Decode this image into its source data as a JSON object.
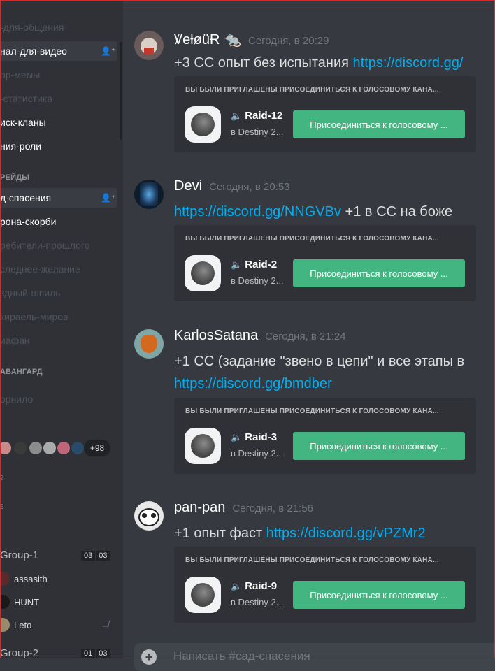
{
  "sidebar": {
    "channels": [
      {
        "label": "-для-общения",
        "state": "dim"
      },
      {
        "label": "нал-для-видео",
        "state": "selected"
      },
      {
        "label": "ор-мемы",
        "state": "dim"
      },
      {
        "label": "-статистика",
        "state": "dim"
      },
      {
        "label": "иск-кланы",
        "state": "bright"
      },
      {
        "label": "ния-роли",
        "state": "bright"
      }
    ],
    "category1": "РЕЙДЫ",
    "raid_channels": [
      {
        "label": "д-спасения",
        "state": "selected"
      },
      {
        "label": "рона-скорби",
        "state": "bright"
      },
      {
        "label": "ребители-прошлого",
        "state": "dim"
      },
      {
        "label": "следнее-желание",
        "state": "dim"
      },
      {
        "label": "здный-шпиль",
        "state": "dim"
      },
      {
        "label": "кираель-миров",
        "state": "dim"
      },
      {
        "label": "иафан",
        "state": "dim"
      }
    ],
    "category2": "АВАНГАРД",
    "vanguard_channel": "орнило",
    "extra_count": "+98",
    "tiny1": "2",
    "tiny2": "3",
    "voice_group1": "Group-1",
    "voice_group1_counts": [
      "03",
      "03"
    ],
    "voice_users": [
      "assasith",
      "HUNT",
      "Leto"
    ],
    "voice_group2": "Group-2",
    "voice_group2_counts": [
      "01",
      "03"
    ]
  },
  "messages": [
    {
      "username": "ꝞeƚøüɌ 🐀",
      "time": "Сегодня, в 20:29",
      "lines": [
        [
          {
            "t": "+3 СС опыт без испытания ",
            "link": false
          },
          {
            "t": "https://discord.gg/",
            "link": true
          }
        ]
      ],
      "invite": {
        "header": "ВЫ БЫЛИ ПРИГЛАШЕНЫ ПРИСОЕДИНИТЬСЯ К ГОЛОСОВОМУ КАНА...",
        "channel": "Raid-12",
        "server": "в Destiny 2...",
        "button": "Присоединиться к голосовому ..."
      }
    },
    {
      "username": "Devi",
      "time": "Сегодня, в 20:53",
      "lines": [
        [
          {
            "t": "https://discord.gg/NNGVBv",
            "link": true
          },
          {
            "t": " +1 в СС на боже",
            "link": false
          }
        ]
      ],
      "invite": {
        "header": "ВЫ БЫЛИ ПРИГЛАШЕНЫ ПРИСОЕДИНИТЬСЯ К ГОЛОСОВОМУ КАНА...",
        "channel": "Raid-2",
        "server": "в Destiny 2...",
        "button": "Присоединиться к голосовому ..."
      }
    },
    {
      "username": "KarlosSatana",
      "time": "Сегодня, в 21:24",
      "lines": [
        [
          {
            "t": "+1 СС (задание \"звено в цепи\" и все этапы в",
            "link": false
          }
        ],
        [
          {
            "t": "https://discord.gg/bmdber",
            "link": true
          }
        ]
      ],
      "invite": {
        "header": "ВЫ БЫЛИ ПРИГЛАШЕНЫ ПРИСОЕДИНИТЬСЯ К ГОЛОСОВОМУ КАНА...",
        "channel": "Raid-3",
        "server": "в Destiny 2...",
        "button": "Присоединиться к голосовому ..."
      }
    },
    {
      "username": "pan-pan",
      "time": "Сегодня, в 21:56",
      "lines": [
        [
          {
            "t": "+1 опыт фаст ",
            "link": false
          },
          {
            "t": "https://discord.gg/vPZMr2",
            "link": true
          }
        ]
      ],
      "invite": {
        "header": "ВЫ БЫЛИ ПРИГЛАШЕНЫ ПРИСОЕДИНИТЬСЯ К ГОЛОСОВОМУ КАНА...",
        "channel": "Raid-9",
        "server": "в Destiny 2...",
        "button": "Присоединиться к голосовому ..."
      }
    }
  ],
  "composer": {
    "placeholder": "Написать #сад-спасения"
  }
}
